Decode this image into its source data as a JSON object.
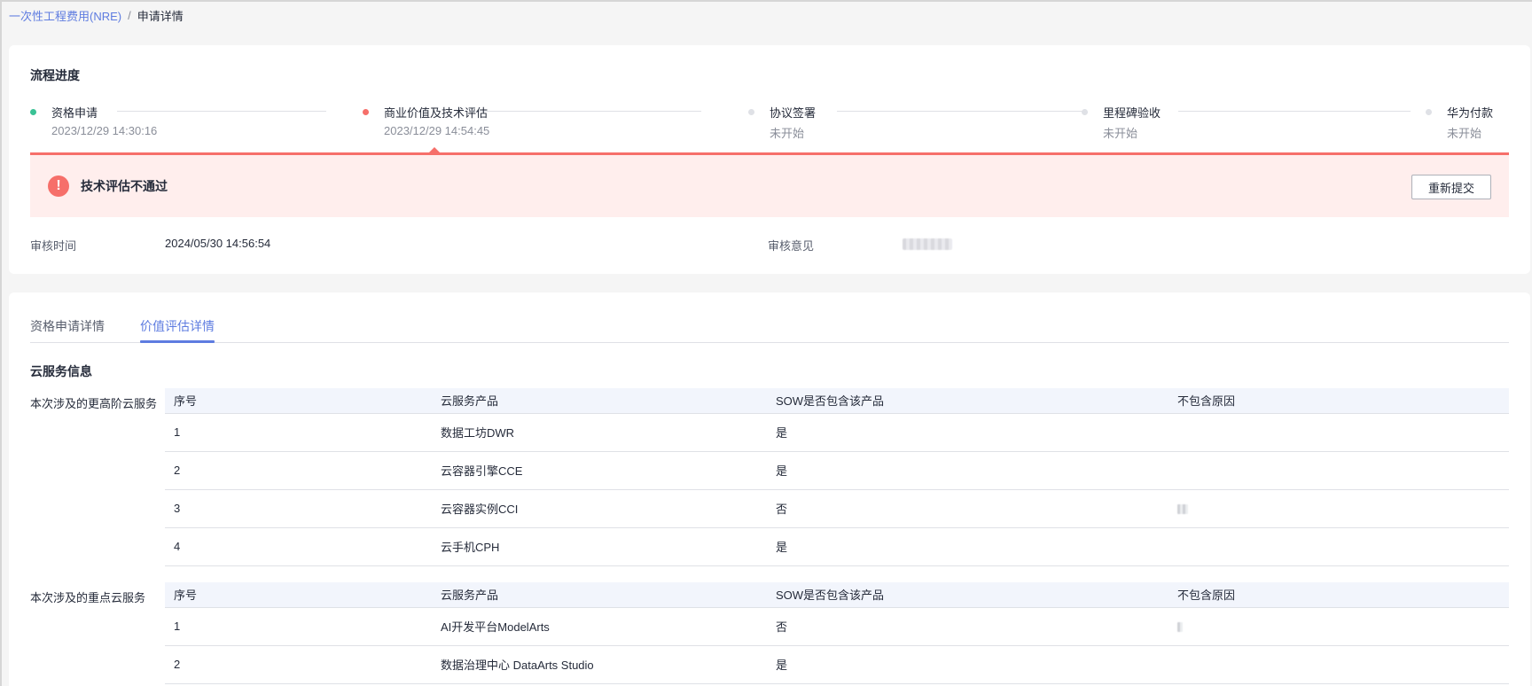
{
  "breadcrumb": {
    "parent": "一次性工程费用(NRE)",
    "separator": "/",
    "current": "申请详情"
  },
  "progress": {
    "title": "流程进度",
    "steps": [
      {
        "name": "资格申请",
        "time": "2023/12/29 14:30:16",
        "status": "done"
      },
      {
        "name": "商业价值及技术评估",
        "time": "2023/12/29 14:54:45",
        "status": "failed"
      },
      {
        "name": "协议签署",
        "time": "未开始",
        "status": "pending"
      },
      {
        "name": "里程碑验收",
        "time": "未开始",
        "status": "pending"
      },
      {
        "name": "华为付款",
        "time": "未开始",
        "status": "pending"
      }
    ],
    "alert": {
      "icon": "exclamation-icon",
      "text": "技术评估不通过",
      "button": "重新提交"
    },
    "review_time_label": "审核时间",
    "review_time_value": "2024/05/30 14:56:54",
    "review_comment_label": "审核意见"
  },
  "detail": {
    "tabs": [
      {
        "label": "资格申请详情",
        "active": false
      },
      {
        "label": "价值评估详情",
        "active": true
      }
    ],
    "section_title": "云服务信息",
    "columns": [
      "序号",
      "云服务产品",
      "SOW是否包含该产品",
      "不包含原因"
    ],
    "groups": [
      {
        "label": "本次涉及的更高阶云服务",
        "rows": [
          {
            "no": "1",
            "product": "数据工坊DWR",
            "included": "是"
          },
          {
            "no": "2",
            "product": "云容器引擎CCE",
            "included": "是"
          },
          {
            "no": "3",
            "product": "云容器实例CCI",
            "included": "否"
          },
          {
            "no": "4",
            "product": "云手机CPH",
            "included": "是"
          }
        ]
      },
      {
        "label": "本次涉及的重点云服务",
        "rows": [
          {
            "no": "1",
            "product": "AI开发平台ModelArts",
            "included": "否"
          },
          {
            "no": "2",
            "product": "数据治理中心 DataArts Studio",
            "included": "是"
          }
        ]
      }
    ]
  },
  "colors": {
    "primary": "#5e7ce0",
    "success": "#3ac295",
    "danger": "#f66f6a",
    "alert_bg": "#ffeeed",
    "pending": "#dfe1e6"
  }
}
